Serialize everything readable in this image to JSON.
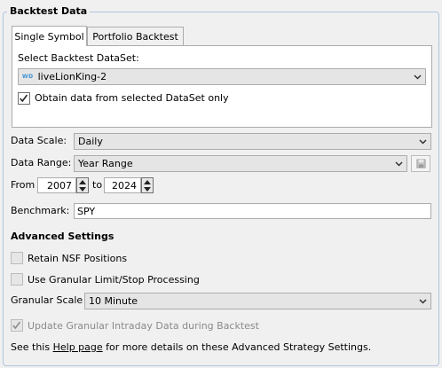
{
  "group": {
    "title": "Backtest Data"
  },
  "tabs": [
    {
      "label": "Single Symbol"
    },
    {
      "label": "Portfolio Backtest"
    }
  ],
  "dataset": {
    "label": "Select Backtest DataSet:",
    "selected": "liveLionKing-2",
    "badge": "WD",
    "obtain_only_label": "Obtain data from selected DataSet only",
    "obtain_only_checked": true
  },
  "data_scale": {
    "label": "Data Scale:",
    "value": "Daily"
  },
  "data_range": {
    "label": "Data Range:",
    "value": "Year Range"
  },
  "range": {
    "from_label": "From",
    "from_value": "2007",
    "to_label": "to",
    "to_value": "2024"
  },
  "benchmark": {
    "label": "Benchmark:",
    "value": "SPY"
  },
  "advanced": {
    "heading": "Advanced Settings",
    "retain_nsf_label": "Retain NSF Positions",
    "retain_nsf_checked": false,
    "granular_limit_label": "Use Granular Limit/Stop Processing",
    "granular_limit_checked": false,
    "granular_scale_label": "Granular Scale",
    "granular_scale_value": "10 Minute",
    "update_intraday_label": "Update Granular Intraday Data during Backtest",
    "update_intraday_checked": true
  },
  "footer": {
    "prefix": "See this ",
    "link": "Help page",
    "suffix": " for more details on these Advanced Strategy Settings."
  },
  "colors": {
    "group_border": "#b0c4de",
    "accent": "#2b6fb6"
  }
}
